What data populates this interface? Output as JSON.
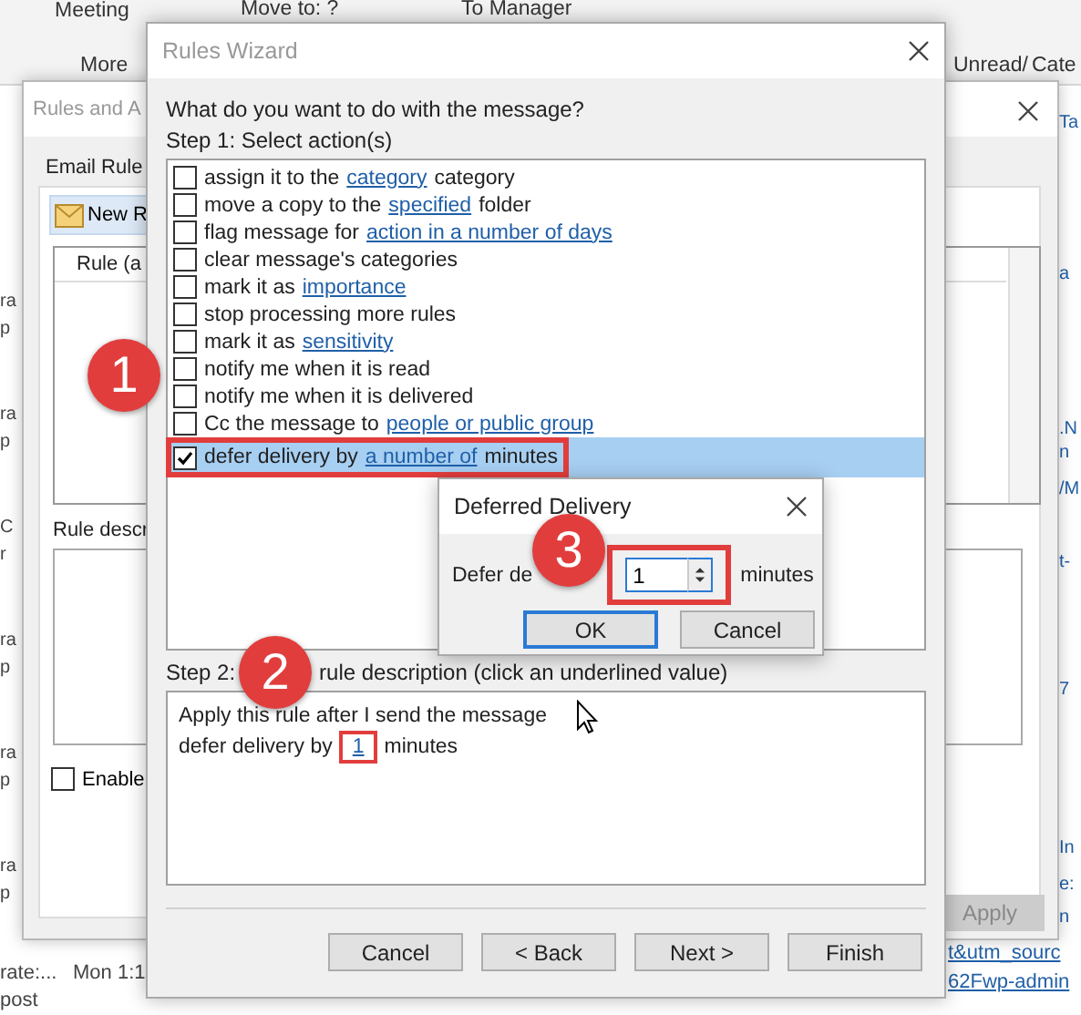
{
  "ribbon": [
    {
      "label": "Meeting"
    },
    {
      "label": "More"
    },
    {
      "label": "Move to: ?"
    },
    {
      "label": "To Manager"
    },
    {
      "label": "Unread/"
    },
    {
      "label": "Cate"
    }
  ],
  "message_list": [
    {
      "line_1": "ra",
      "line_2": "p"
    },
    {
      "line_1": "ra",
      "line_2": "p"
    },
    {
      "line_1": "C",
      "line_2": "r"
    },
    {
      "line_1": "ra",
      "line_2": "p"
    },
    {
      "line_1": "ra",
      "line_2": "p"
    },
    {
      "line_1": "ra",
      "line_2": "p"
    }
  ],
  "message_footer": {
    "sender": "rate:...",
    "time": "Mon 1:1",
    "preview": "post"
  },
  "side_text": [
    "Ta",
    "a",
    ".N",
    "n",
    "/M",
    "t-",
    "7",
    "In",
    "e:",
    "n"
  ],
  "bottom_links": [
    "t&utm_sourc",
    "62Fwp-admin"
  ],
  "rules_and_alerts": {
    "title": "Rules and A",
    "tab": "Email Rule",
    "new_rule": "New R",
    "column": "Rule (a",
    "description_label": "Rule descr",
    "enable": {
      "label": "Enable",
      "checked": false
    },
    "apply": {
      "label": "Apply",
      "disabled": true
    }
  },
  "rules_wizard": {
    "title": "Rules Wizard",
    "question": "What do you want to do with the message?",
    "step_1": "Step 1: Select action(s)",
    "actions": [
      {
        "checked": false,
        "selected": false,
        "highlighted": false,
        "parts": [
          {
            "text": "assign it to the",
            "kind": "text"
          },
          {
            "text": "category",
            "kind": "link"
          },
          {
            "text": "category",
            "kind": "text"
          }
        ]
      },
      {
        "checked": false,
        "selected": false,
        "highlighted": false,
        "parts": [
          {
            "text": "move a copy to the",
            "kind": "text"
          },
          {
            "text": "specified",
            "kind": "link"
          },
          {
            "text": "folder",
            "kind": "text"
          }
        ]
      },
      {
        "checked": false,
        "selected": false,
        "highlighted": false,
        "parts": [
          {
            "text": "flag message for",
            "kind": "text"
          },
          {
            "text": "action in a number of days",
            "kind": "link"
          }
        ]
      },
      {
        "checked": false,
        "selected": false,
        "highlighted": false,
        "parts": [
          {
            "text": "clear message's categories",
            "kind": "text"
          }
        ]
      },
      {
        "checked": false,
        "selected": false,
        "highlighted": false,
        "parts": [
          {
            "text": "mark it as",
            "kind": "text"
          },
          {
            "text": "importance",
            "kind": "link"
          }
        ]
      },
      {
        "checked": false,
        "selected": false,
        "highlighted": false,
        "parts": [
          {
            "text": "stop processing more rules",
            "kind": "text"
          }
        ]
      },
      {
        "checked": false,
        "selected": false,
        "highlighted": false,
        "parts": [
          {
            "text": "mark it as",
            "kind": "text"
          },
          {
            "text": "sensitivity",
            "kind": "link"
          }
        ]
      },
      {
        "checked": false,
        "selected": false,
        "highlighted": false,
        "parts": [
          {
            "text": "notify me when it is read",
            "kind": "text"
          }
        ]
      },
      {
        "checked": false,
        "selected": false,
        "highlighted": false,
        "parts": [
          {
            "text": "notify me when it is delivered",
            "kind": "text"
          }
        ]
      },
      {
        "checked": false,
        "selected": false,
        "highlighted": false,
        "parts": [
          {
            "text": "Cc the message to",
            "kind": "text"
          },
          {
            "text": "people or public group",
            "kind": "link"
          }
        ]
      },
      {
        "checked": true,
        "selected": true,
        "highlighted": true,
        "parts": [
          {
            "text": "defer delivery by",
            "kind": "text"
          },
          {
            "text": "a number of",
            "kind": "link"
          },
          {
            "text": "minutes",
            "kind": "text"
          }
        ]
      }
    ],
    "step_2": {
      "prefix": "Step 2:",
      "rest": "rule description (click an underlined value)"
    },
    "description": [
      [
        {
          "text": "Apply this rule after I send the message",
          "kind": "text",
          "highlighted": false
        }
      ],
      [
        {
          "text": "defer delivery by",
          "kind": "text",
          "highlighted": false
        },
        {
          "text": "1",
          "kind": "link",
          "highlighted": true
        },
        {
          "text": "minutes",
          "kind": "text",
          "highlighted": false
        }
      ]
    ],
    "buttons": [
      "Cancel",
      "< Back",
      "Next >",
      "Finish"
    ]
  },
  "deferred_delivery": {
    "title": "Deferred Delivery",
    "label": "Defer de",
    "value": "1",
    "highlighted": true,
    "unit": "minutes",
    "buttons": [
      "OK",
      "Cancel"
    ]
  },
  "annotations": [
    "1",
    "2",
    "3"
  ]
}
